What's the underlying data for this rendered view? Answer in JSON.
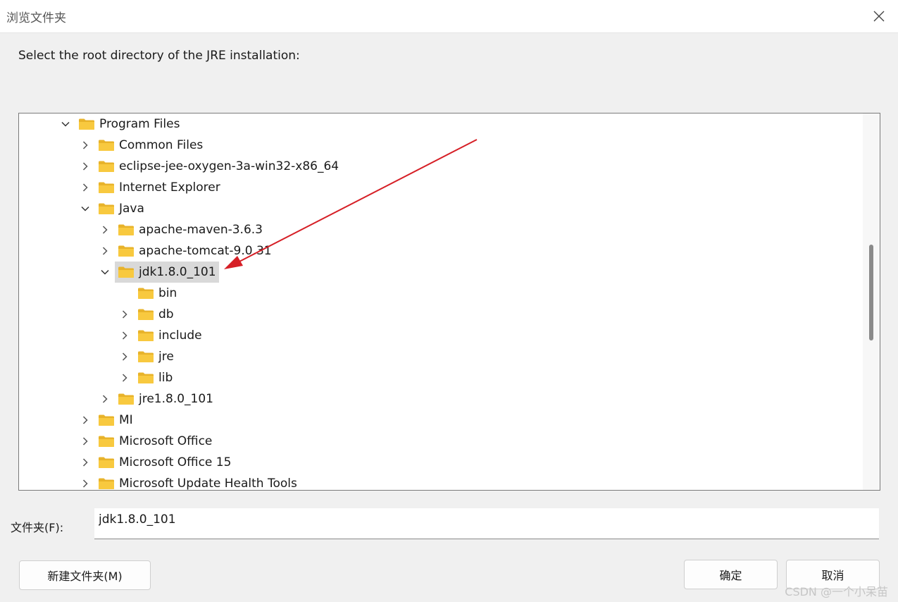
{
  "window": {
    "title": "浏览文件夹",
    "close_icon": "close-icon"
  },
  "dialog": {
    "instruction": "Select the root directory of the JRE installation:"
  },
  "tree": {
    "items": [
      {
        "label": "Program Files",
        "level": 0,
        "expander": "expanded"
      },
      {
        "label": "Common Files",
        "level": 1,
        "expander": "collapsed"
      },
      {
        "label": "eclipse-jee-oxygen-3a-win32-x86_64",
        "level": 1,
        "expander": "collapsed"
      },
      {
        "label": "Internet Explorer",
        "level": 1,
        "expander": "collapsed"
      },
      {
        "label": "Java",
        "level": 1,
        "expander": "expanded"
      },
      {
        "label": "apache-maven-3.6.3",
        "level": 2,
        "expander": "collapsed"
      },
      {
        "label": "apache-tomcat-9.0.31",
        "level": 2,
        "expander": "collapsed"
      },
      {
        "label": "jdk1.8.0_101",
        "level": 2,
        "expander": "expanded",
        "selected": true
      },
      {
        "label": "bin",
        "level": 3,
        "expander": "none"
      },
      {
        "label": "db",
        "level": 3,
        "expander": "collapsed"
      },
      {
        "label": "include",
        "level": 3,
        "expander": "collapsed"
      },
      {
        "label": "jre",
        "level": 3,
        "expander": "collapsed"
      },
      {
        "label": "lib",
        "level": 3,
        "expander": "collapsed"
      },
      {
        "label": "jre1.8.0_101",
        "level": 2,
        "expander": "collapsed"
      },
      {
        "label": "MI",
        "level": 1,
        "expander": "collapsed"
      },
      {
        "label": "Microsoft Office",
        "level": 1,
        "expander": "collapsed"
      },
      {
        "label": "Microsoft Office 15",
        "level": 1,
        "expander": "collapsed"
      },
      {
        "label": "Microsoft Update Health Tools",
        "level": 1,
        "expander": "collapsed"
      }
    ]
  },
  "folder_field": {
    "label": "文件夹(F):",
    "value": "jdk1.8.0_101"
  },
  "buttons": {
    "new_folder": "新建文件夹(M)",
    "ok": "确定",
    "cancel": "取消"
  },
  "watermark": "CSDN @一个小呆苗",
  "colors": {
    "folder": "#f8c93f",
    "arrow": "#d61f26",
    "selection": "#d9d9d9"
  }
}
